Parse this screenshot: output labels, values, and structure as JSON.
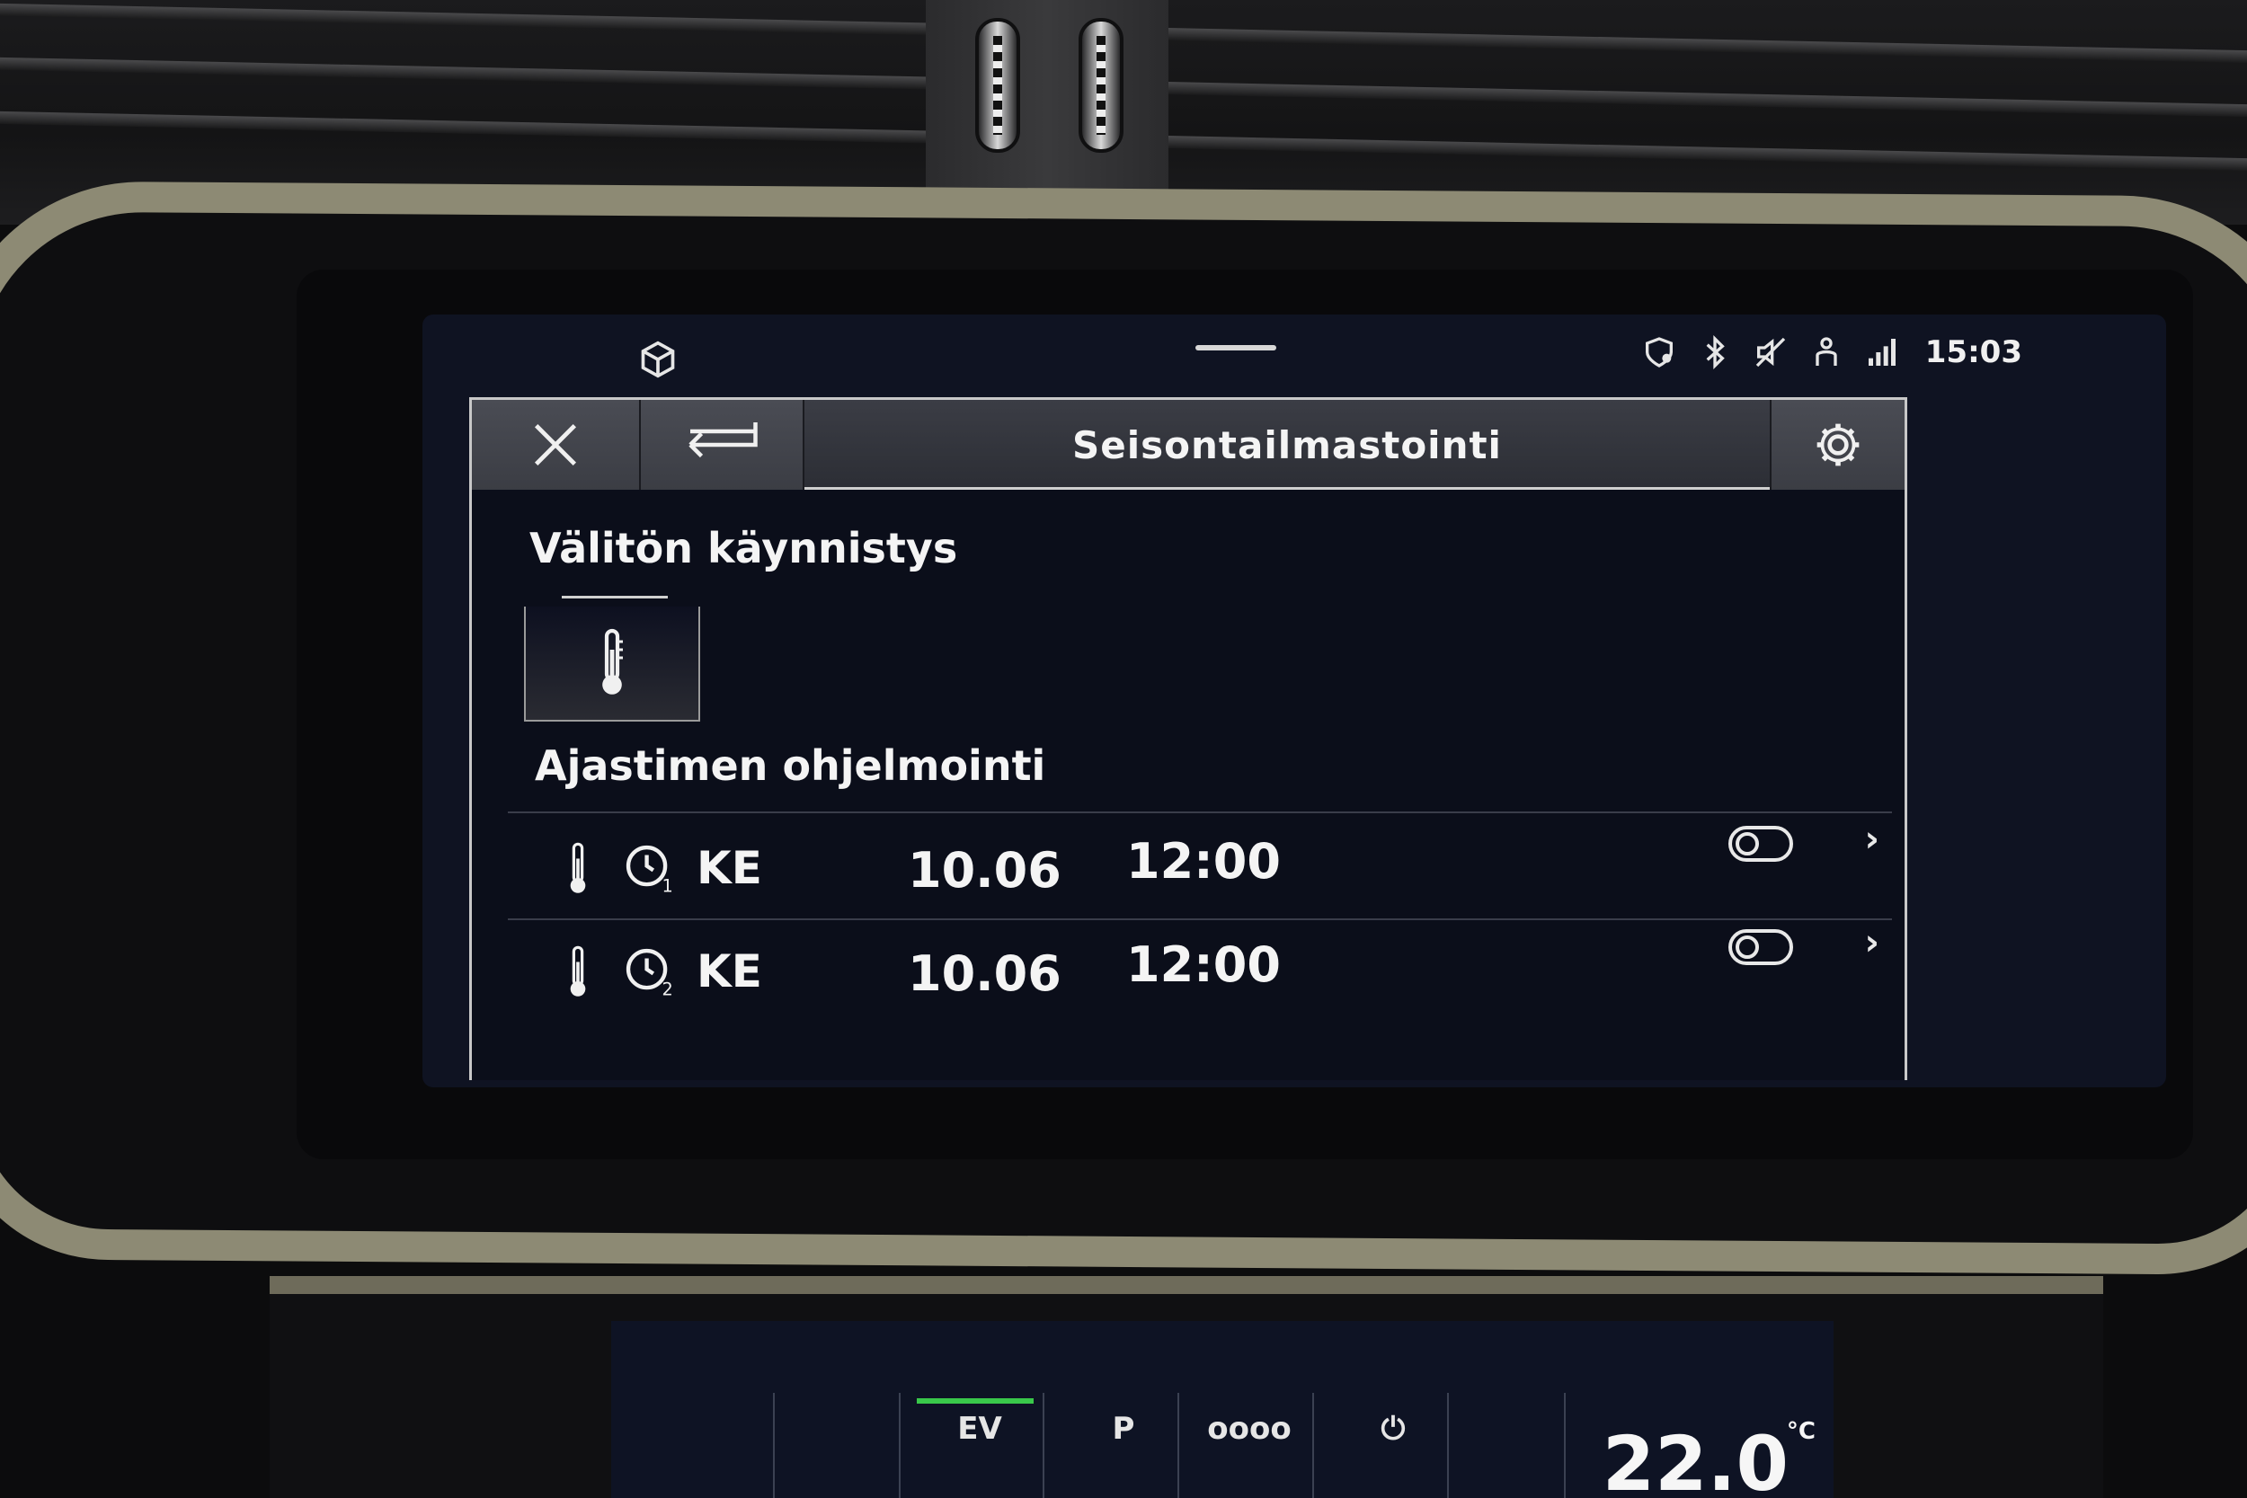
{
  "status_bar": {
    "clock": "15:03",
    "icons": [
      "app-box-icon",
      "location-pin-icon",
      "bluetooth-icon",
      "speaker-muted-icon",
      "person-icon",
      "lte-signal-icon"
    ]
  },
  "window": {
    "title": "Seisontailmastointi",
    "close_icon": "close-icon",
    "back_icon": "back-arrow-icon",
    "settings_icon": "gear-icon"
  },
  "instant_start": {
    "heading": "Välitön käynnistys",
    "tile_icon": "thermometer-icon"
  },
  "timer_programming": {
    "heading": "Ajastimen ohjelmointi",
    "timers": [
      {
        "clock_icon": "timer-1-clock-icon",
        "day": "KE",
        "date": "10.06",
        "time": "12:00",
        "enabled": false
      },
      {
        "clock_icon": "timer-2-clock-icon",
        "day": "KE",
        "date": "10.06",
        "time": "12:00",
        "enabled": false
      }
    ]
  },
  "climate_strip": {
    "tabs": [
      {
        "label": "EV",
        "active": true
      },
      {
        "label": "P",
        "active": false
      },
      {
        "label": "oooo",
        "active": false
      },
      {
        "label": "⏻",
        "active": false
      }
    ],
    "temperature": "22.0",
    "unit": "°C"
  },
  "colors": {
    "screen_bg": "#0f1322",
    "titlebar_bg": "#2c2e35",
    "active_tab_accent": "#39c84a",
    "text": "#f4f4f4"
  }
}
